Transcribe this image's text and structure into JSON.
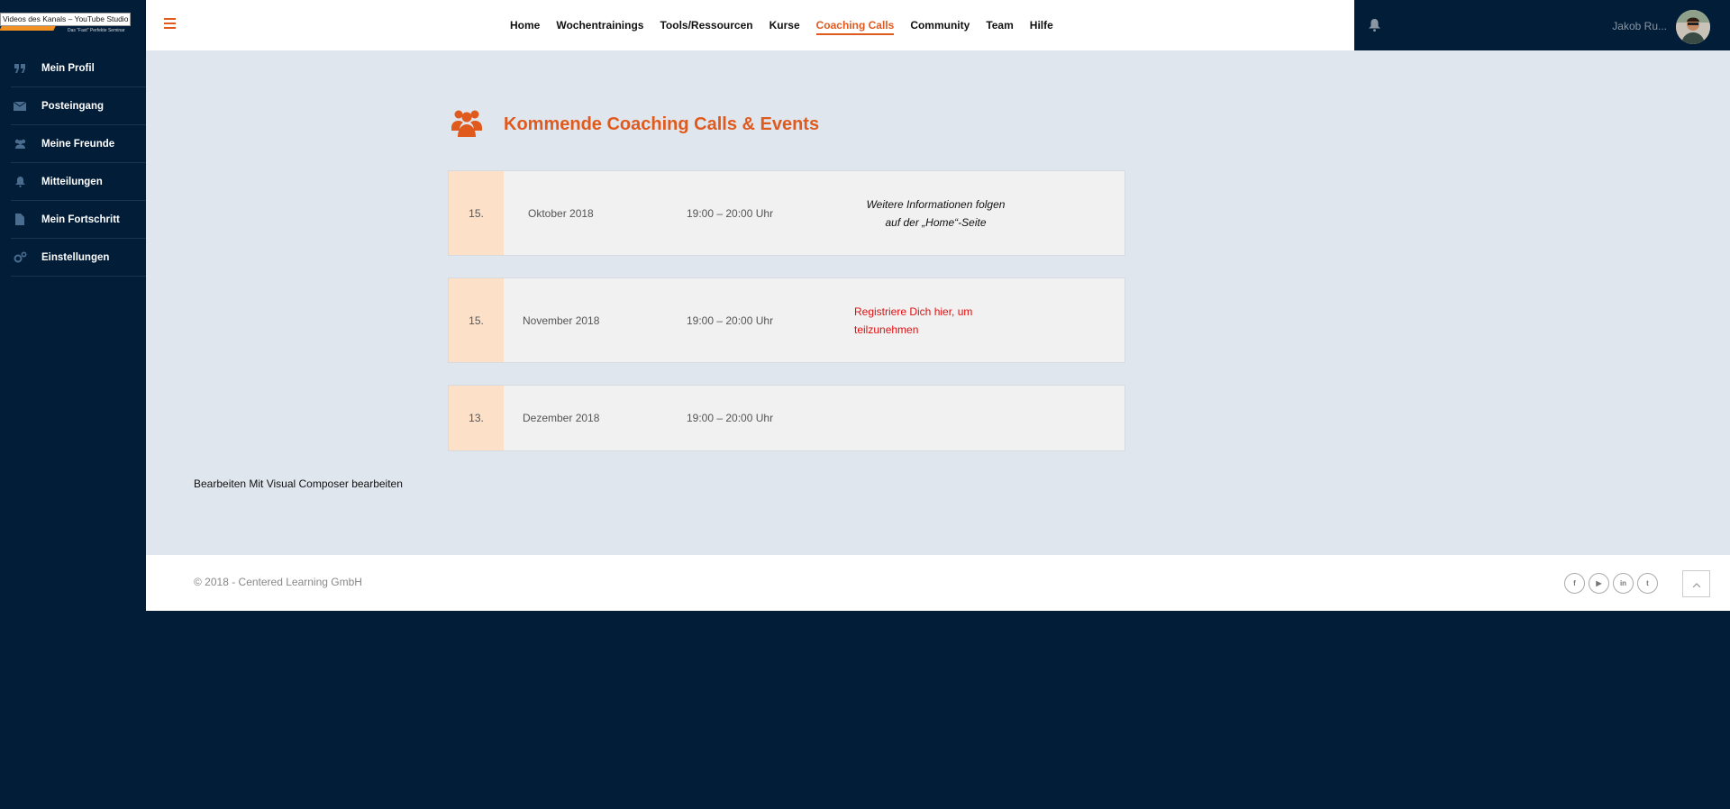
{
  "sidebar": {
    "logo_tooltip": "Videos des Kanals – YouTube Studio",
    "logo_sub": "Das \"Fast\" Perfekte Seminar",
    "items": [
      {
        "label": "Mein Profil",
        "icon": "quote-icon"
      },
      {
        "label": "Posteingang",
        "icon": "envelope-icon"
      },
      {
        "label": "Meine Freunde",
        "icon": "users-icon"
      },
      {
        "label": "Mitteilungen",
        "icon": "bell-icon"
      },
      {
        "label": "Mein Fortschritt",
        "icon": "document-icon"
      },
      {
        "label": "Einstellungen",
        "icon": "gears-icon"
      }
    ]
  },
  "topnav": {
    "items": [
      {
        "label": "Home"
      },
      {
        "label": "Wochentrainings"
      },
      {
        "label": "Tools/Ressourcen"
      },
      {
        "label": "Kurse"
      },
      {
        "label": "Coaching Calls",
        "active": true
      },
      {
        "label": "Community"
      },
      {
        "label": "Team"
      },
      {
        "label": "Hilfe"
      }
    ]
  },
  "user": {
    "name": "Jakob Ru..."
  },
  "main": {
    "title": "Kommende Coaching Calls & Events",
    "events": [
      {
        "day": "15.",
        "month": "Oktober 2018",
        "time": "19:00 – 20:00 Uhr",
        "info_line1": "Weitere Informationen folgen",
        "info_line2": "auf der „Home“-Seite"
      },
      {
        "day": "15.",
        "month": "November 2018",
        "time": "19:00 – 20:00 Uhr",
        "register_line1": "Registriere Dich hier, um",
        "register_line2": "teilzunehmen"
      },
      {
        "day": "13.",
        "month": "Dezember 2018",
        "time": "19:00 – 20:00 Uhr"
      }
    ],
    "edit_link": "Bearbeiten Mit Visual Composer bearbeiten"
  },
  "footer": {
    "copyright": "© 2018 - Centered Learning GmbH",
    "socials": [
      {
        "icon": "facebook-icon",
        "glyph": "f"
      },
      {
        "icon": "youtube-icon",
        "glyph": "▶"
      },
      {
        "icon": "linkedin-icon",
        "glyph": "in"
      },
      {
        "icon": "twitter-icon",
        "glyph": "t"
      }
    ]
  },
  "colors": {
    "accent": "#e05a1e",
    "navy": "#011d38",
    "register_red": "#e01010",
    "day_bg": "#fde0c8"
  }
}
